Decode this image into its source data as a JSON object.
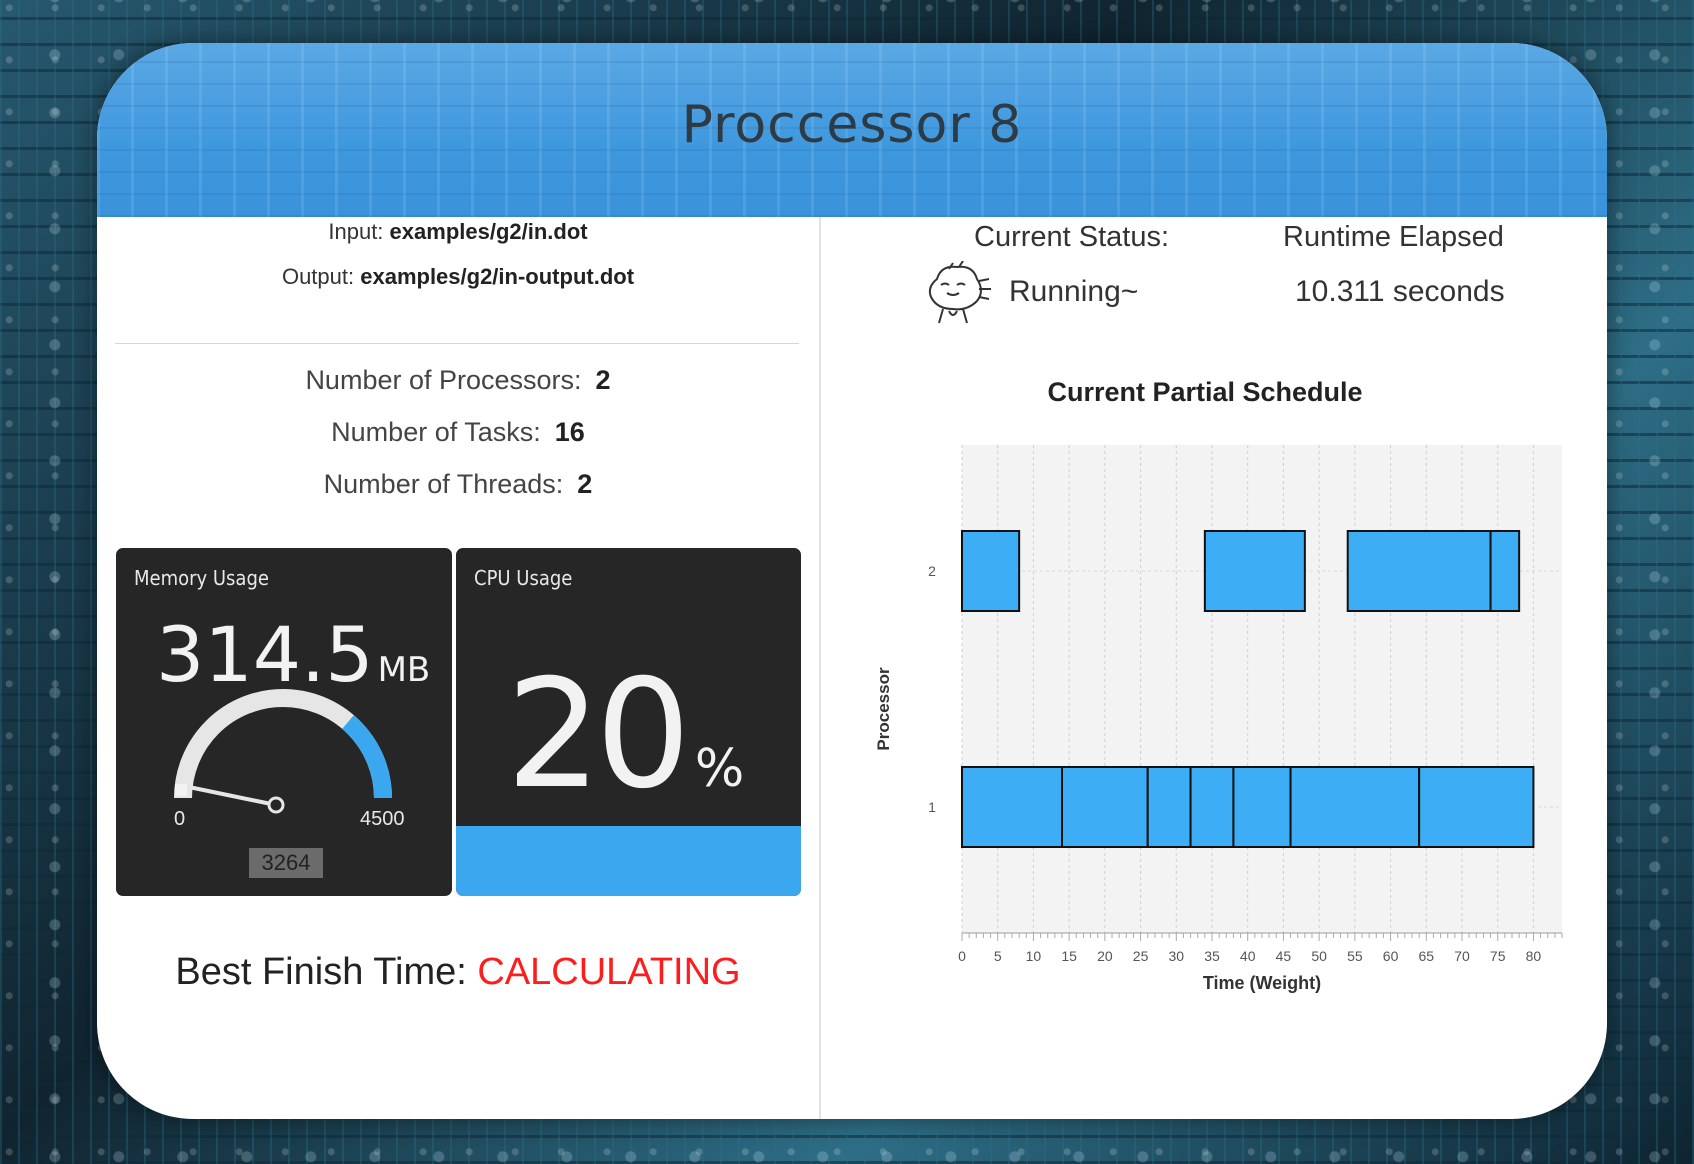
{
  "window": {
    "title": "Proccessor 8"
  },
  "io": {
    "input_label": "Input:",
    "input_value": "examples/g2/in.dot",
    "output_label": "Output:",
    "output_value": "examples/g2/in-output.dot"
  },
  "stats": {
    "processors_label": "Number of Processors:",
    "processors_value": "2",
    "tasks_label": "Number of Tasks:",
    "tasks_value": "16",
    "threads_label": "Number of Threads:",
    "threads_value": "2"
  },
  "memory": {
    "title": "Memory Usage",
    "value": "314.5",
    "unit": "MB",
    "gauge_min": "0",
    "gauge_max": "4500",
    "gauge_current": "3264",
    "gauge_fraction": 0.7253,
    "accent": "#3aa7ee"
  },
  "cpu": {
    "title": "CPU Usage",
    "value": "20",
    "unit": "%",
    "fill_fraction": 0.2,
    "accent": "#3aa7ee"
  },
  "best": {
    "label": "Best Finish Time:",
    "value": "CALCULATING",
    "value_color": "#ff1c1c"
  },
  "status": {
    "label": "Current Status:",
    "value": "Running~",
    "icon": "cartoon-face-icon",
    "runtime_label": "Runtime Elapsed",
    "runtime_value": "10.311 seconds"
  },
  "chart_data": {
    "type": "gantt",
    "title": "Current Partial Schedule",
    "xlabel": "Time (Weight)",
    "ylabel": "Processor",
    "xlim": [
      0,
      84
    ],
    "xticks": [
      0,
      5,
      10,
      15,
      20,
      25,
      30,
      35,
      40,
      45,
      50,
      55,
      60,
      65,
      70,
      75,
      80
    ],
    "yticks": [
      2,
      1
    ],
    "bar_color": "#3daef5",
    "tasks": [
      {
        "processor": 2,
        "start": 0,
        "end": 8
      },
      {
        "processor": 2,
        "start": 34,
        "end": 48
      },
      {
        "processor": 2,
        "start": 54,
        "end": 74
      },
      {
        "processor": 2,
        "start": 74,
        "end": 78
      },
      {
        "processor": 1,
        "start": 0,
        "end": 14
      },
      {
        "processor": 1,
        "start": 14,
        "end": 26
      },
      {
        "processor": 1,
        "start": 26,
        "end": 32
      },
      {
        "processor": 1,
        "start": 32,
        "end": 38
      },
      {
        "processor": 1,
        "start": 38,
        "end": 46
      },
      {
        "processor": 1,
        "start": 46,
        "end": 64
      },
      {
        "processor": 1,
        "start": 64,
        "end": 80
      }
    ]
  }
}
